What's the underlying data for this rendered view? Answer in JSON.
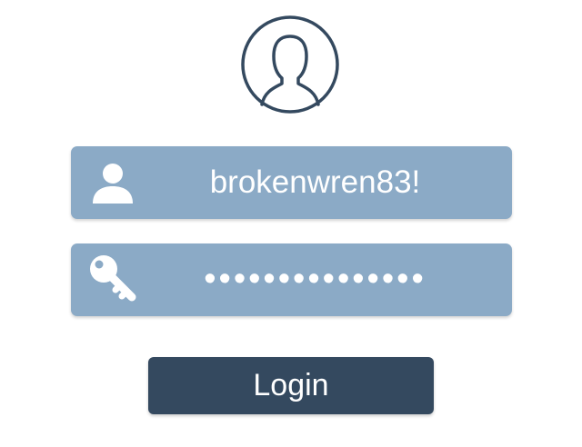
{
  "avatar": {
    "icon": "user-silhouette-icon"
  },
  "username_field": {
    "icon": "user-icon",
    "value": "brokenwren83!"
  },
  "password_field": {
    "icon": "key-icon",
    "masked_value": "•••••••••••••••"
  },
  "login_button": {
    "label": "Login"
  },
  "colors": {
    "field_background": "#8baac6",
    "button_background": "#34495f",
    "avatar_stroke": "#34495f",
    "text": "#ffffff"
  }
}
